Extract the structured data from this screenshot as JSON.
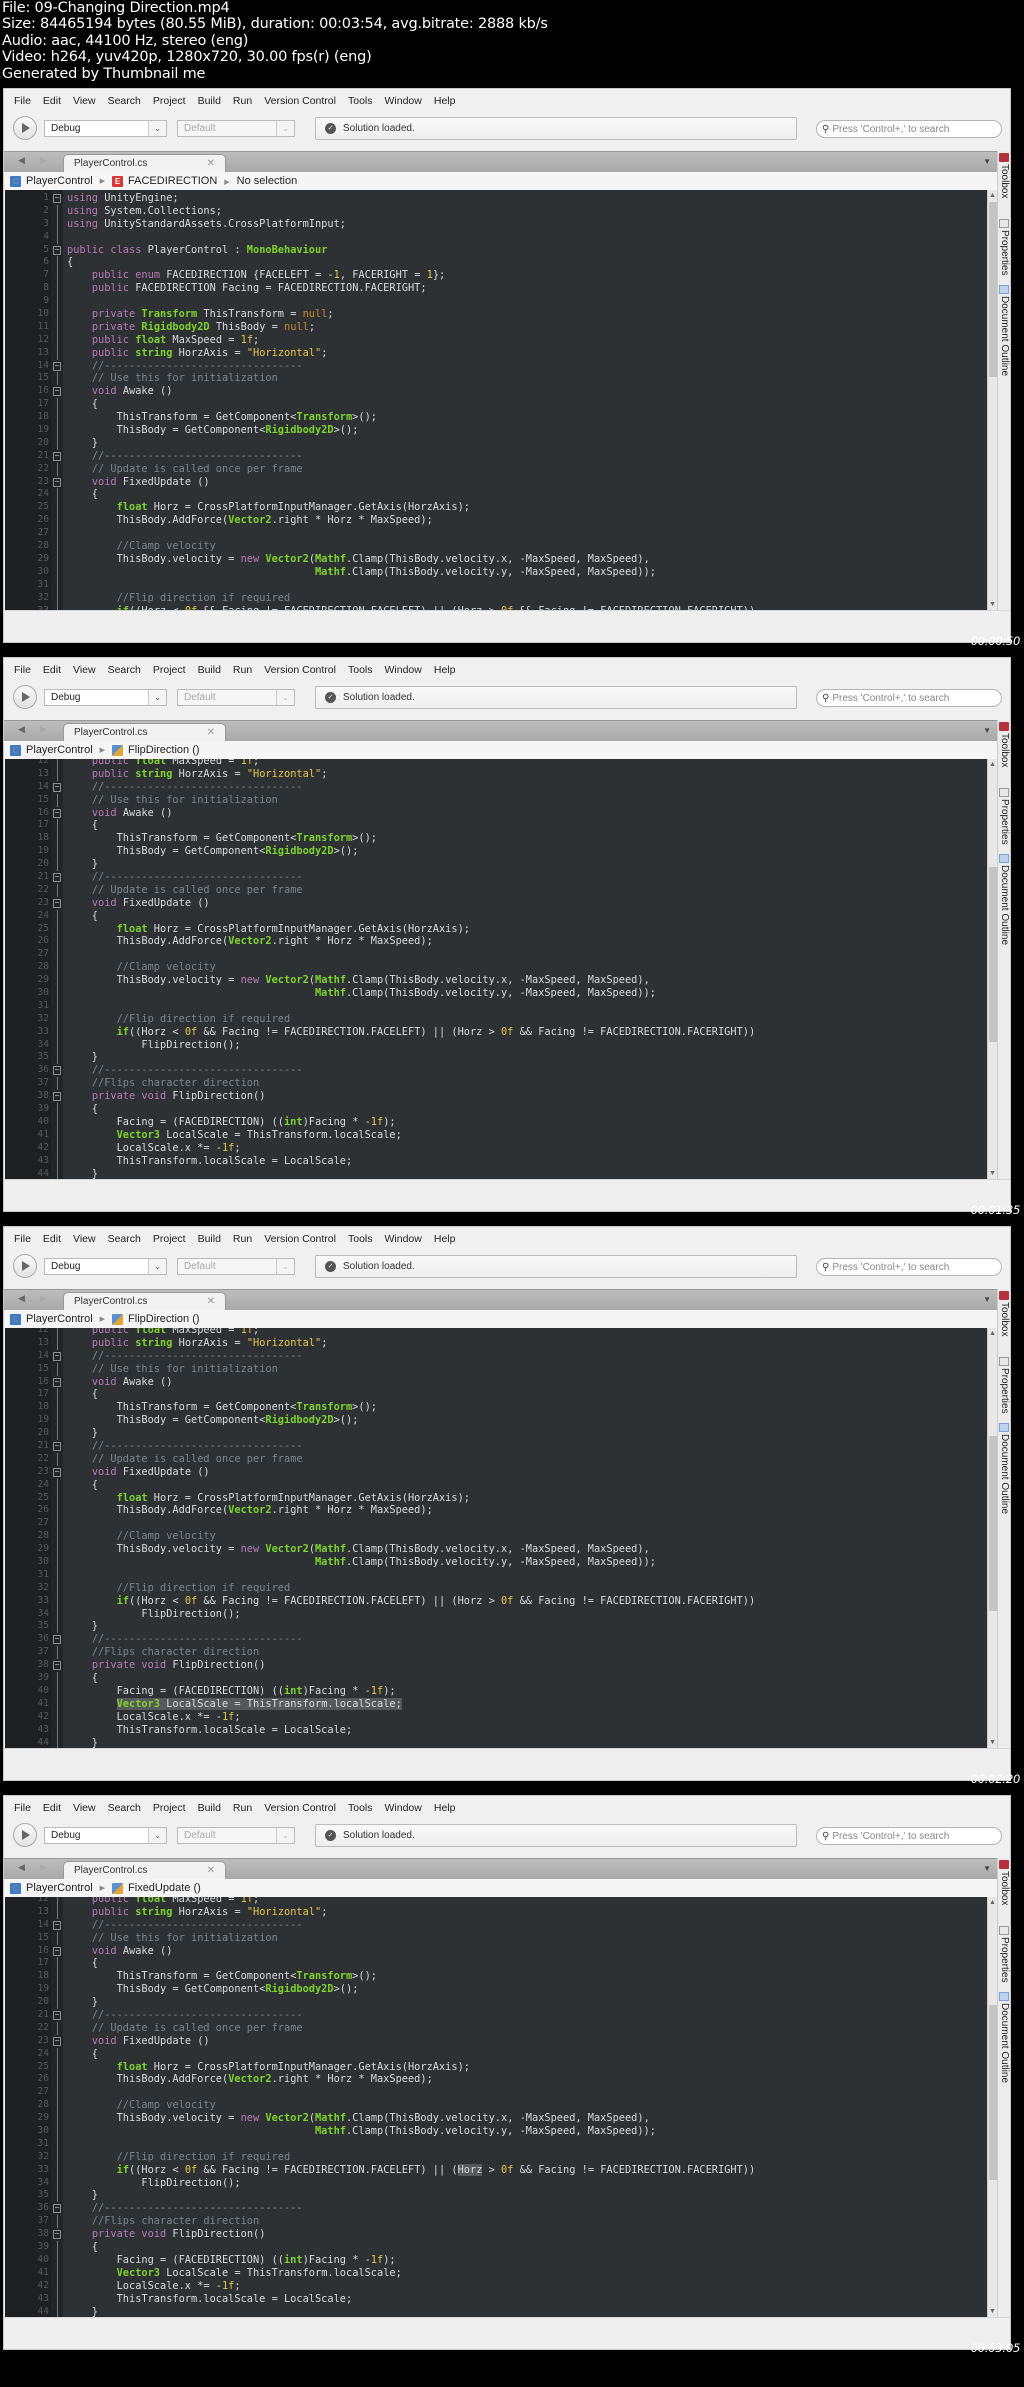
{
  "fileinfo": {
    "file": "File: 09-Changing Direction.mp4",
    "size": "Size: 84465194 bytes (80.55 MiB), duration: 00:03:54, avg.bitrate: 2888 kb/s",
    "audio": "Audio: aac, 44100 Hz, stereo (eng)",
    "video": "Video: h264, yuv420p, 1280x720, 30.00 fps(r) (eng)",
    "generator": "Generated by Thumbnail me"
  },
  "ide": {
    "menu": [
      "File",
      "Edit",
      "View",
      "Search",
      "Project",
      "Build",
      "Run",
      "Version Control",
      "Tools",
      "Window",
      "Help"
    ],
    "config_combo": "Debug",
    "platform_combo": "Default",
    "status": "Solution loaded.",
    "search_placeholder": "Press 'Control+,' to search",
    "tab_label": "PlayerControl.cs",
    "side_panels": [
      "Toolbox",
      "Properties",
      "Document Outline"
    ],
    "colors": {
      "editor_bg": "#2d3134",
      "keyword": "#b77bb5",
      "type": "#7fd32e",
      "number": "#e6c84a",
      "comment": "#7f858a"
    }
  },
  "code_lines": {
    "1": "using UnityEngine;",
    "2": "using System.Collections;",
    "3": "using UnityStandardAssets.CrossPlatformInput;",
    "4": "",
    "5": "public class PlayerControl : MonoBehaviour",
    "6": "{",
    "7": "    public enum FACEDIRECTION {FACELEFT = -1, FACERIGHT = 1};",
    "8": "    public FACEDIRECTION Facing = FACEDIRECTION.FACERIGHT;",
    "9": "",
    "10": "    private Transform ThisTransform = null;",
    "11": "    private Rigidbody2D ThisBody = null;",
    "12": "    public float MaxSpeed = 1f;",
    "13": "    public string HorzAxis = \"Horizontal\";",
    "14": "    //--------------------------------",
    "15": "    // Use this for initialization",
    "16": "    void Awake ()",
    "17": "    {",
    "18": "        ThisTransform = GetComponent<Transform>();",
    "19": "        ThisBody = GetComponent<Rigidbody2D>();",
    "20": "    }",
    "21": "    //--------------------------------",
    "22": "    // Update is called once per frame",
    "23": "    void FixedUpdate ()",
    "24": "    {",
    "25": "        float Horz = CrossPlatformInputManager.GetAxis(HorzAxis);",
    "26": "        ThisBody.AddForce(Vector2.right * Horz * MaxSpeed);",
    "27": "",
    "28": "        //Clamp velocity",
    "29": "        ThisBody.velocity = new Vector2(Mathf.Clamp(ThisBody.velocity.x, -MaxSpeed, MaxSpeed),",
    "30": "                                        Mathf.Clamp(ThisBody.velocity.y, -MaxSpeed, MaxSpeed));",
    "31": "",
    "32": "        //Flip direction if required",
    "33": "        if((Horz < 0f && Facing != FACEDIRECTION.FACELEFT) || (Horz > 0f && Facing != FACEDIRECTION.FACERIGHT))",
    "34": "            FlipDirection();",
    "35": "    }",
    "36": "    //--------------------------------",
    "37": "    //Flips character direction",
    "38": "    private void FlipDirection()",
    "39": "    {",
    "40": "        Facing = (FACEDIRECTION) ((int)Facing * -1f);",
    "41": "        Vector3 LocalScale = ThisTransform.localScale;",
    "42": "        LocalScale.x *= -1f;",
    "43": "        ThisTransform.localScale = LocalScale;",
    "44": "    }",
    "45": "    //--------------------------------",
    "46": "}",
    "47": ""
  },
  "frames": [
    {
      "timestamp": "00:00:50",
      "breadcrumb": {
        "class": "PlayerControl",
        "member": "FACEDIRECTION",
        "member_icon": "enum",
        "extra": "No selection"
      },
      "first_line": 1,
      "last_line": 36,
      "scroll_fraction": 0.0
    },
    {
      "timestamp": "00:01:35",
      "breadcrumb": {
        "class": "PlayerControl",
        "member": "FlipDirection ()",
        "member_icon": "method",
        "extra": ""
      },
      "first_line": 12,
      "last_line": 47,
      "scroll_fraction": 0.45
    },
    {
      "timestamp": "00:02:20",
      "breadcrumb": {
        "class": "PlayerControl",
        "member": "FlipDirection ()",
        "member_icon": "method",
        "extra": ""
      },
      "first_line": 12,
      "last_line": 47,
      "scroll_fraction": 0.45,
      "selected_line": 41
    },
    {
      "timestamp": "00:03:05",
      "breadcrumb": {
        "class": "PlayerControl",
        "member": "FixedUpdate ()",
        "member_icon": "method",
        "extra": ""
      },
      "first_line": 12,
      "last_line": 47,
      "scroll_fraction": 0.45,
      "highlighted_word": "Horz"
    }
  ]
}
